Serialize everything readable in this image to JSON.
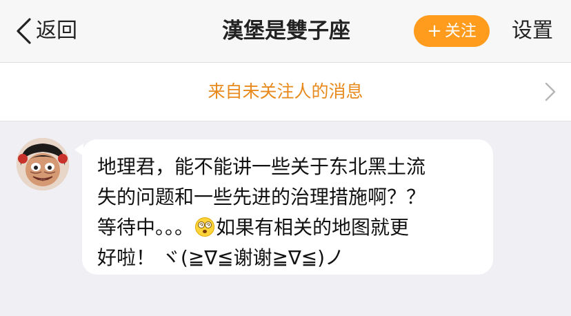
{
  "nav": {
    "back_label": "返回",
    "title": "漢堡是雙子座",
    "follow_plus": "+",
    "follow_label": "关注",
    "settings_label": "设置"
  },
  "banner": {
    "label": "来自未关注人的消息"
  },
  "message": {
    "line1": "地理君，能不能讲一些关于东北黑土流",
    "line2": "失的问题和一些先进的治理措施啊？？",
    "line3_before": "等待中。。。",
    "line3_emoji": "dizzy-face-emoji",
    "line3_after": "如果有相关的地图就更",
    "line4": "好啦！ ヾ(≧∇≦谢谢≧∇≦)ノ"
  },
  "colors": {
    "accent": "#ff9c1d",
    "banner_text": "#e8891c",
    "page_bg": "#efeff4",
    "bubble_bg": "#ffffff"
  }
}
